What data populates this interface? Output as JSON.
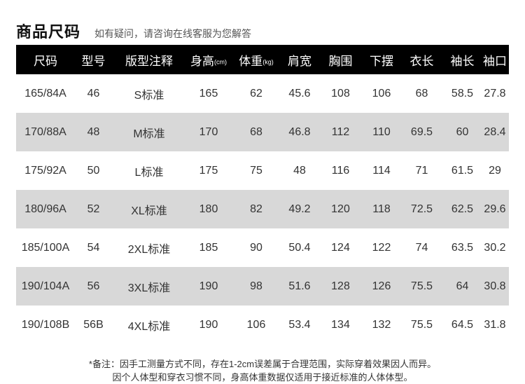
{
  "header": {
    "title": "商品尺码",
    "subtitle": "如有疑问，请咨询在线客服为您解答"
  },
  "table": {
    "columns": [
      {
        "label": "尺码",
        "unit": ""
      },
      {
        "label": "型号",
        "unit": ""
      },
      {
        "label": "版型注释",
        "unit": ""
      },
      {
        "label": "身高",
        "unit": "(cm)"
      },
      {
        "label": "体重",
        "unit": "(kg)"
      },
      {
        "label": "肩宽",
        "unit": ""
      },
      {
        "label": "胸围",
        "unit": ""
      },
      {
        "label": "下摆",
        "unit": ""
      },
      {
        "label": "衣长",
        "unit": ""
      },
      {
        "label": "袖长",
        "unit": ""
      },
      {
        "label": "袖口",
        "unit": ""
      }
    ],
    "rows": [
      [
        "165/84A",
        "46",
        "S标准",
        "165",
        "62",
        "45.6",
        "108",
        "106",
        "68",
        "58.5",
        "27.8"
      ],
      [
        "170/88A",
        "48",
        "M标准",
        "170",
        "68",
        "46.8",
        "112",
        "110",
        "69.5",
        "60",
        "28.4"
      ],
      [
        "175/92A",
        "50",
        "L标准",
        "175",
        "75",
        "48",
        "116",
        "114",
        "71",
        "61.5",
        "29"
      ],
      [
        "180/96A",
        "52",
        "XL标准",
        "180",
        "82",
        "49.2",
        "120",
        "118",
        "72.5",
        "62.5",
        "29.6"
      ],
      [
        "185/100A",
        "54",
        "2XL标准",
        "185",
        "90",
        "50.4",
        "124",
        "122",
        "74",
        "63.5",
        "30.2"
      ],
      [
        "190/104A",
        "56",
        "3XL标准",
        "190",
        "98",
        "51.6",
        "128",
        "126",
        "75.5",
        "64",
        "30.8"
      ],
      [
        "190/108B",
        "56B",
        "4XL标准",
        "190",
        "106",
        "53.4",
        "134",
        "132",
        "75.5",
        "64.5",
        "31.8"
      ]
    ]
  },
  "footer": {
    "line1": "*备注：因手工测量方式不同，存在1-2cm误差属于合理范围，实际穿着效果因人而异。",
    "line2": "因个人体型和穿衣习惯不同，身高体重数据仅适用于接近标准的人体体型。"
  },
  "colors": {
    "header_bg": "#000000",
    "stripe": "#d8d8d8"
  }
}
